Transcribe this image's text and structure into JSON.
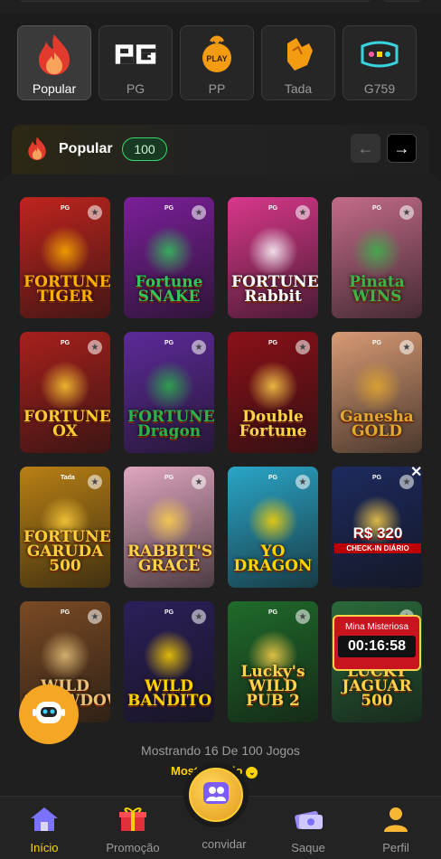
{
  "providers": [
    {
      "label": "Popular",
      "icon": "flame-icon",
      "active": true
    },
    {
      "label": "PG",
      "icon": "pg-logo-icon",
      "active": false
    },
    {
      "label": "PP",
      "icon": "pp-play-icon",
      "active": false
    },
    {
      "label": "Tada",
      "icon": "tada-hand-icon",
      "active": false
    },
    {
      "label": "G759",
      "icon": "g759-logo-icon",
      "active": false
    }
  ],
  "section": {
    "title": "Popular",
    "count": "100",
    "prev_icon": "arrow-left-icon",
    "next_icon": "arrow-right-icon"
  },
  "games": [
    {
      "title": "FORTUNE TIGER",
      "badge": "PG",
      "bg": "#c0241e",
      "fg": "#ffb000"
    },
    {
      "title": "Fortune SNAKE",
      "badge": "PG",
      "bg": "#7b1f9a",
      "fg": "#33c45a"
    },
    {
      "title": "FORTUNE Rabbit",
      "badge": "PG",
      "bg": "#d9378b",
      "fg": "#fff"
    },
    {
      "title": "Pinata WINS",
      "badge": "PG",
      "bg": "#c46b8a",
      "fg": "#3cb44a"
    },
    {
      "title": "FORTUNE OX",
      "badge": "PG",
      "bg": "#a8201c",
      "fg": "#ffcc33"
    },
    {
      "title": "FORTUNE Dragon",
      "badge": "PG",
      "bg": "#5d2a9a",
      "fg": "#2bb24c"
    },
    {
      "title": "Double Fortune",
      "badge": "PG",
      "bg": "#8c1018",
      "fg": "#ffd34a"
    },
    {
      "title": "Ganesha GOLD",
      "badge": "PG",
      "bg": "#d89a74",
      "fg": "#e3a82e"
    },
    {
      "title": "FORTUNE GARUDA 500",
      "badge": "Tada",
      "bg": "#b98014",
      "fg": "#ffcf3a"
    },
    {
      "title": "RABBIT'S GRACE",
      "badge": "PG",
      "bg": "#e0a6c0",
      "fg": "#ffd34a"
    },
    {
      "title": "YO DRAGON",
      "badge": "PG",
      "bg": "#2aa6c8",
      "fg": "#ffd400"
    },
    {
      "title": "",
      "badge": "PG",
      "bg": "#1d2a5e",
      "fg": "#ffd34a"
    },
    {
      "title": "WILD SHOWDOWN",
      "badge": "PG",
      "bg": "#7a4a24",
      "fg": "#e7c27a"
    },
    {
      "title": "WILD BANDITO",
      "badge": "PG",
      "bg": "#2c1f5a",
      "fg": "#ffd400"
    },
    {
      "title": "Lucky's WILD PUB 2",
      "badge": "PG",
      "bg": "#1f6b2a",
      "fg": "#ffd34a"
    },
    {
      "title": "LUCKY JAGUAR 500",
      "badge": "",
      "bg": "#2a6a3a",
      "fg": "#ffd34a"
    }
  ],
  "promo": {
    "amount": "R$ 320",
    "checkin": "CHECK-IN DIÁRIO",
    "mystery_title": "Mina Misteriosa",
    "timer": "00:16:58"
  },
  "footer": {
    "showing": "Mostrando 16 De 100 Jogos",
    "show_all": "Mostrar tudo"
  },
  "nav": [
    {
      "label": "Início",
      "icon": "home-icon",
      "active": true
    },
    {
      "label": "Promoção",
      "icon": "gift-icon",
      "active": false
    },
    {
      "label": "convidar",
      "icon": "invite-people-icon",
      "active": false
    },
    {
      "label": "Saque",
      "icon": "withdraw-icon",
      "active": false
    },
    {
      "label": "Perfil",
      "icon": "profile-icon",
      "active": false
    }
  ],
  "colors": {
    "accent": "#ffd400",
    "badge_green": "#3bd46e",
    "bg": "#1c1c1c"
  }
}
